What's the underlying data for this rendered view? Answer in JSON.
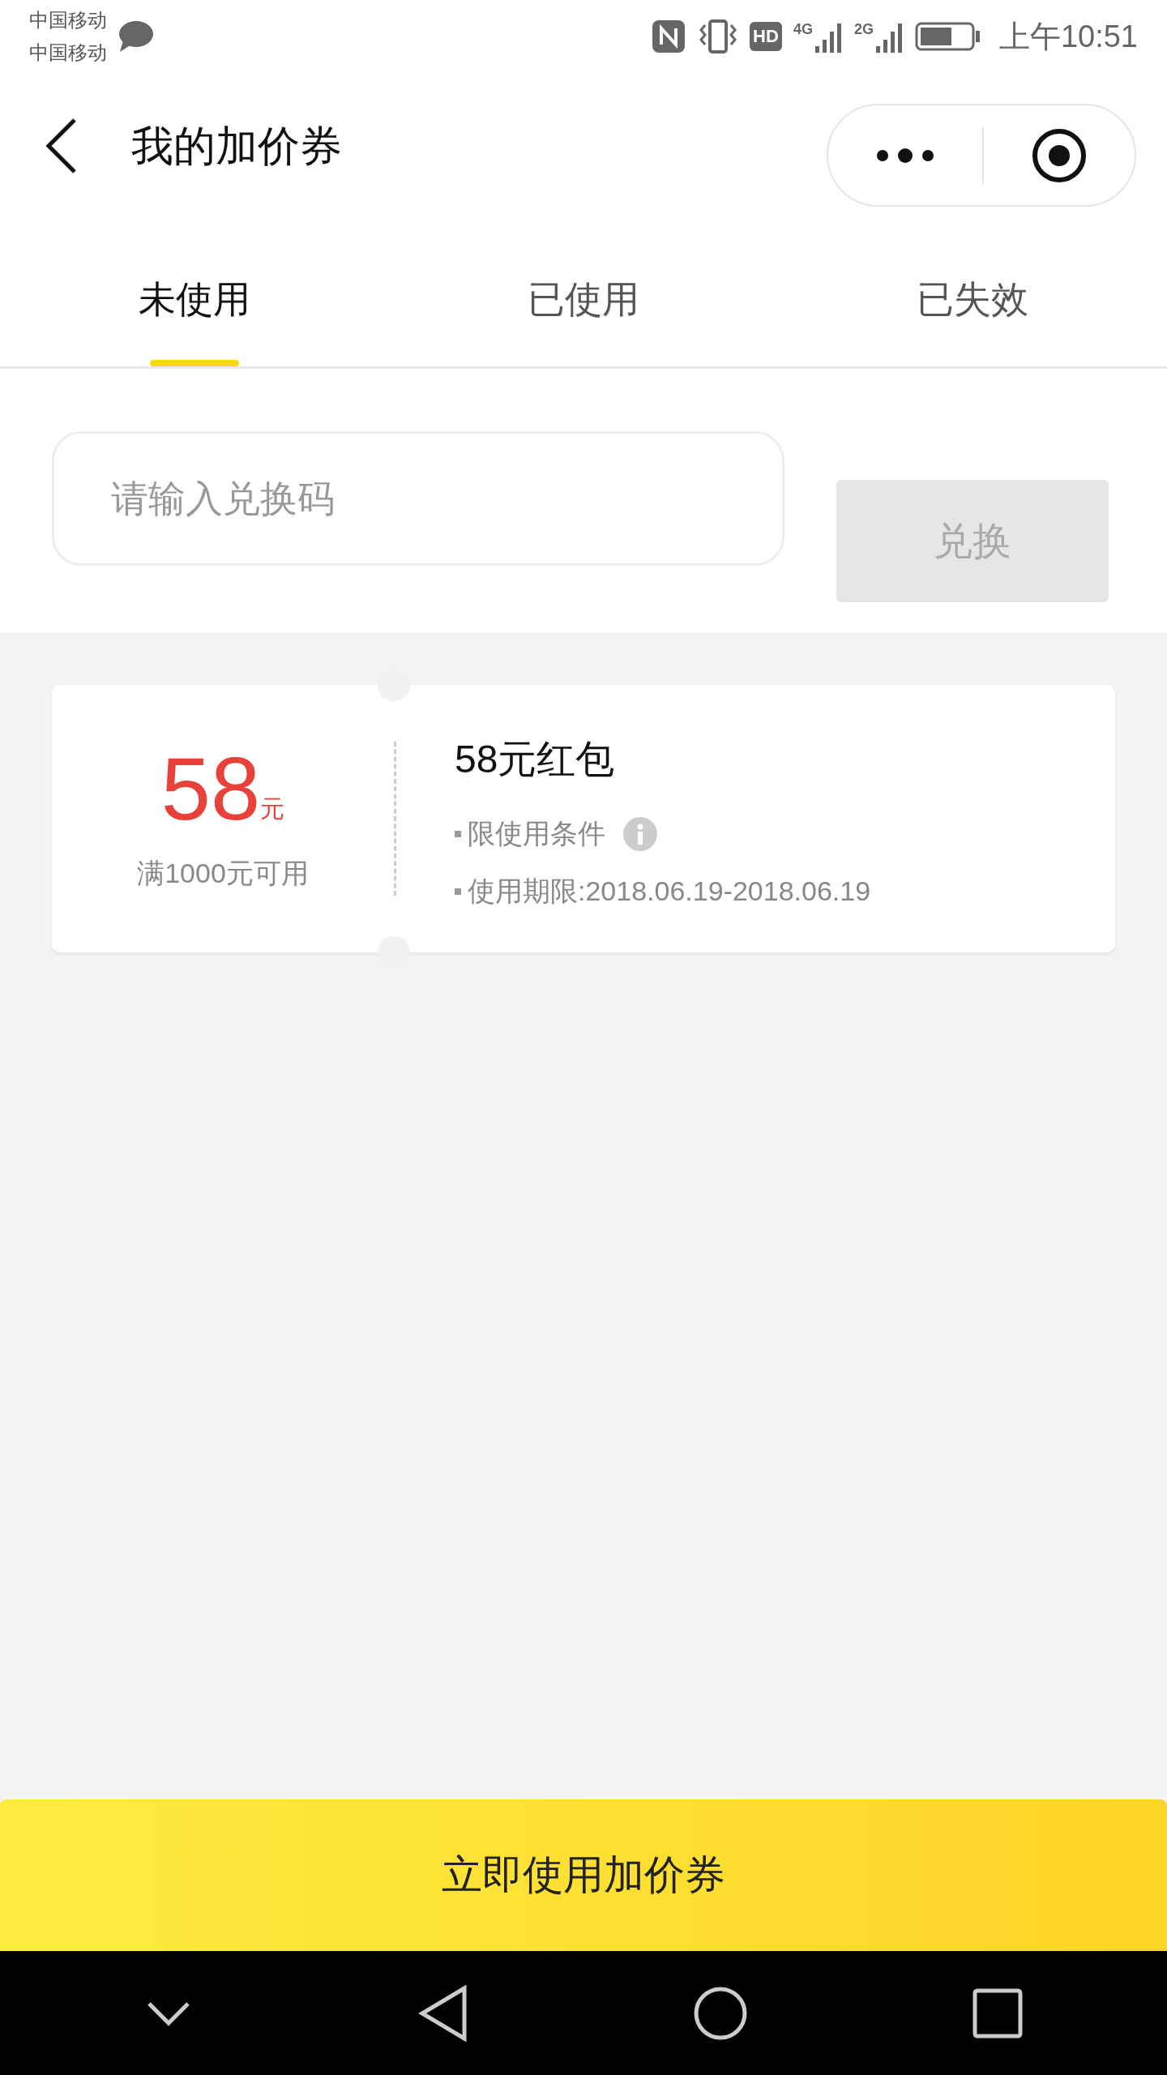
{
  "status_bar": {
    "carriers": [
      "中国移动",
      "中国移动"
    ],
    "indicators": [
      "HD",
      "4G",
      "2G"
    ],
    "time": "上午10:51"
  },
  "nav": {
    "title": "我的加价券"
  },
  "tabs": [
    {
      "label": "未使用",
      "selected": true
    },
    {
      "label": "已使用",
      "selected": false
    },
    {
      "label": "已失效",
      "selected": false
    }
  ],
  "redeem": {
    "placeholder": "请输入兑换码",
    "button": "兑换",
    "disabled": true
  },
  "coupons": [
    {
      "amount": "58",
      "unit": "元",
      "condition": "满1000元可用",
      "title": "58元红包",
      "rule": "限使用条件",
      "validity": "使用期限:2018.06.19-2018.06.19"
    }
  ],
  "cta": "立即使用加价券"
}
